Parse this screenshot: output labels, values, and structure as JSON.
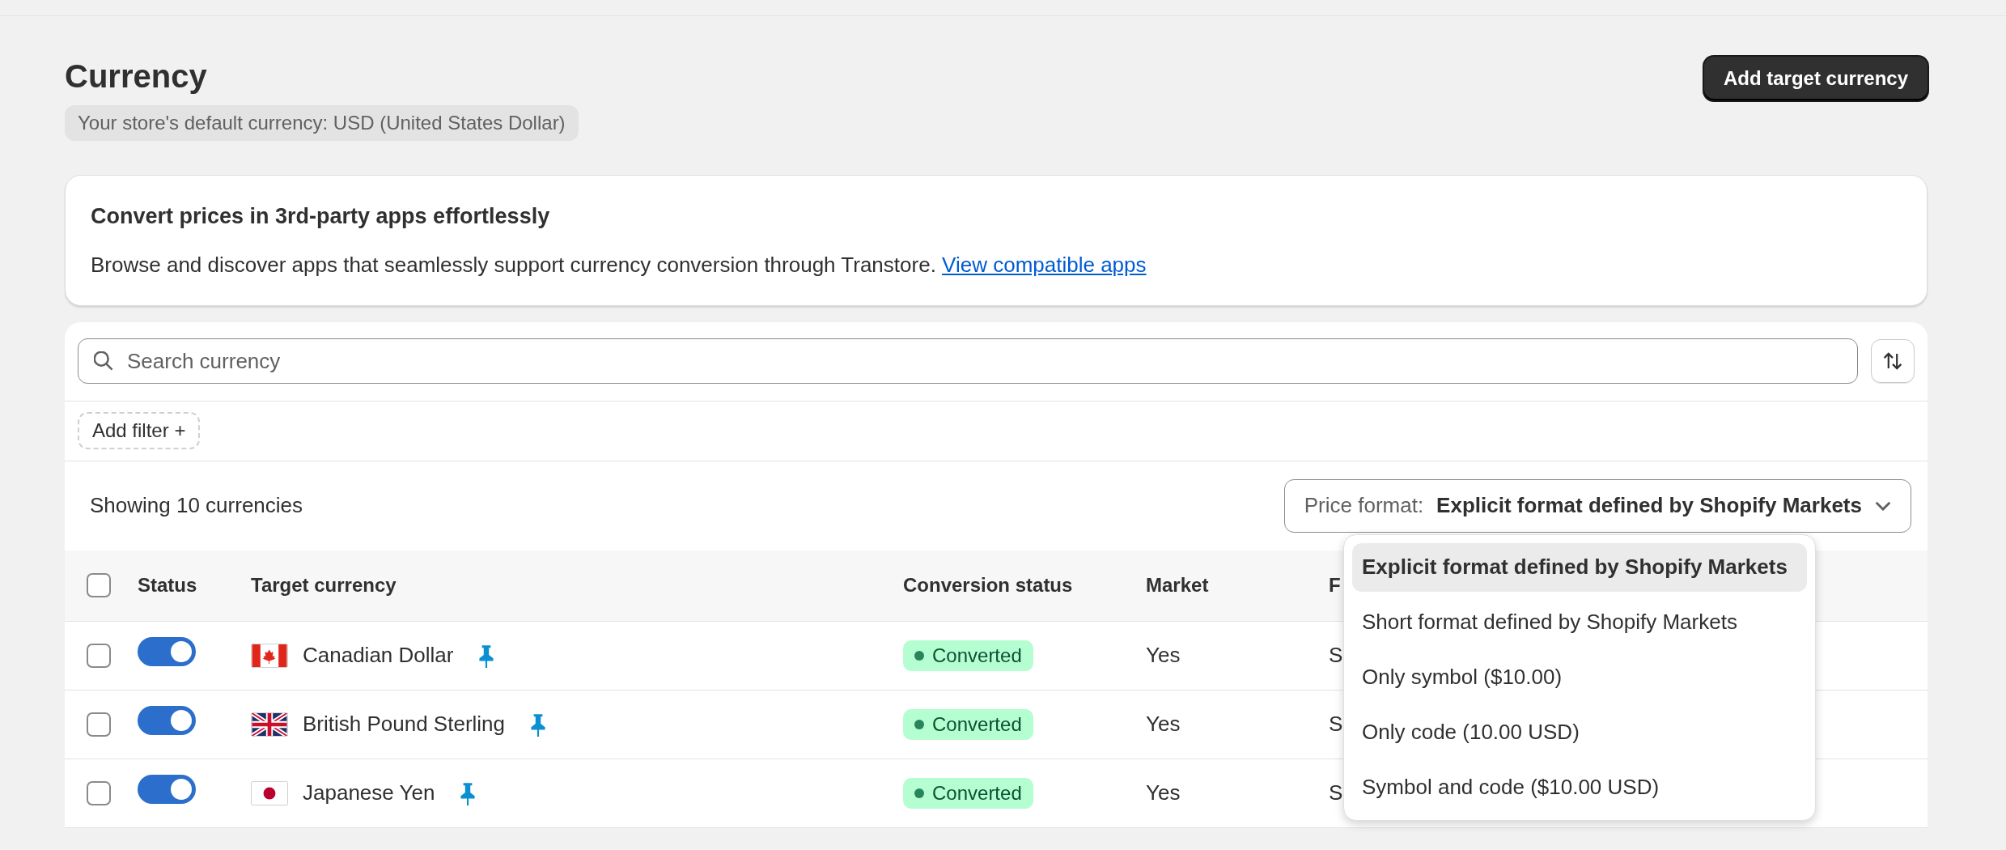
{
  "page": {
    "title": "Currency",
    "default_currency": "Your store's default currency: USD (United States Dollar)",
    "primary_button": "Add target currency"
  },
  "promo": {
    "title": "Convert prices in 3rd-party apps effortlessly",
    "text": "Browse and discover apps that seamlessly support currency conversion through Transtore.",
    "link": "View compatible apps"
  },
  "search": {
    "placeholder": "Search currency"
  },
  "filter_button": "Add filter +",
  "summary": "Showing 10 currencies",
  "price_format": {
    "label": "Price format:",
    "value": "Explicit format defined by Shopify Markets",
    "expanded": true,
    "options": [
      {
        "label": "Explicit format defined by Shopify Markets",
        "selected": true
      },
      {
        "label": "Short format defined by Shopify Markets",
        "selected": false
      },
      {
        "label": "Only symbol ($10.00)",
        "selected": false
      },
      {
        "label": "Only code (10.00 USD)",
        "selected": false
      },
      {
        "label": "Symbol and code ($10.00 USD)",
        "selected": false
      }
    ]
  },
  "table": {
    "all_checked": false,
    "columns": [
      "Status",
      "Target currency",
      "Conversion status",
      "Market",
      "F"
    ],
    "rows": [
      {
        "checked": false,
        "on": true,
        "kind": "ca",
        "currency": "Canadian Dollar",
        "pinned": true,
        "conversion": "Converted",
        "market": "Yes",
        "column_5": "S"
      },
      {
        "checked": false,
        "on": true,
        "kind": "gb",
        "currency": "British Pound Sterling",
        "pinned": true,
        "conversion": "Converted",
        "market": "Yes",
        "column_5": "S"
      },
      {
        "checked": false,
        "on": true,
        "kind": "jp",
        "currency": "Japanese Yen",
        "pinned": true,
        "conversion": "Converted",
        "market": "Yes",
        "column_5": "S"
      }
    ]
  }
}
